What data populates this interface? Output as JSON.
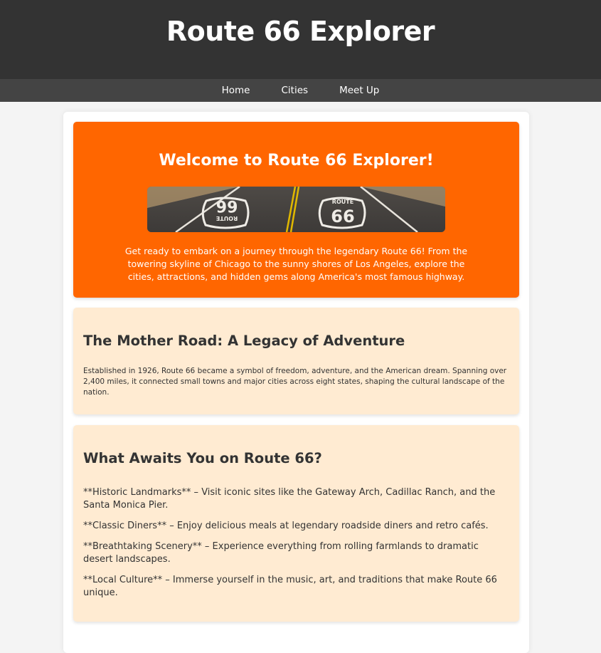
{
  "header": {
    "title": "Route 66 Explorer"
  },
  "nav": {
    "items": [
      "Home",
      "Cities",
      "Meet Up"
    ]
  },
  "hero": {
    "title": "Welcome to Route 66 Explorer!",
    "image_alt": "Route 66 road shields painted on asphalt",
    "text": "Get ready to embark on a journey through the legendary Route 66! From the towering skyline of Chicago to the sunny shores of Los Angeles, explore the cities, attractions, and hidden gems along America's most famous highway."
  },
  "legacy": {
    "title": "The Mother Road: A Legacy of Adventure",
    "text": "Established in 1926, Route 66 became a symbol of freedom, adventure, and the American dream. Spanning over 2,400 miles, it connected small towns and major cities across eight states, shaping the cultural landscape of the nation."
  },
  "awaits": {
    "title": "What Awaits You on Route 66?",
    "items": [
      "**Historic Landmarks** – Visit iconic sites like the Gateway Arch, Cadillac Ranch, and the Santa Monica Pier.",
      "**Classic Diners** – Enjoy delicious meals at legendary roadside diners and retro cafés.",
      "**Breathtaking Scenery** – Experience everything from rolling farmlands to dramatic desert landscapes.",
      "**Local Culture** – Immerse yourself in the music, art, and traditions that make Route 66 unique."
    ]
  },
  "colors": {
    "header_bg": "#333333",
    "nav_bg": "#444444",
    "hero_bg": "#ff6600",
    "card_bg": "#ffebd2",
    "page_bg": "#f4f4f4"
  }
}
